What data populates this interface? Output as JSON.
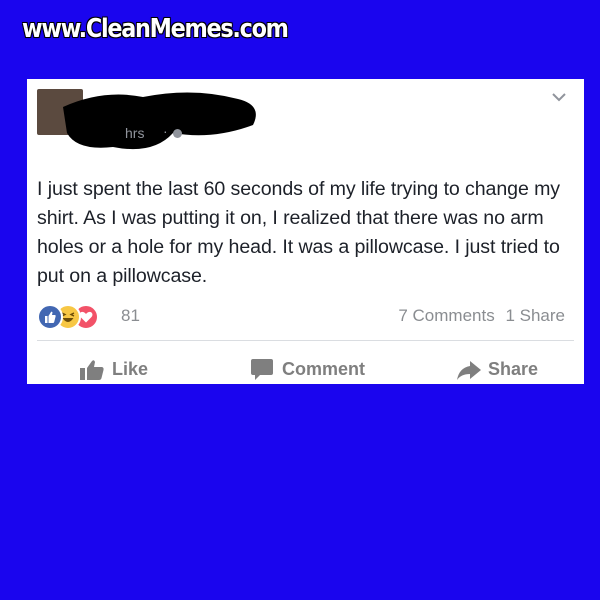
{
  "watermark": {
    "text": "www.CleanMemes.com"
  },
  "post": {
    "timestamp": "hrs",
    "text": "I just spent the last 60 seconds of my life trying to change my shirt. As I was putting it on, I realized that there was no arm holes or a hole for my head. It was a pillowcase. I just tried to put on a pillowcase.",
    "reactions": {
      "icons": [
        "like-icon",
        "haha-icon",
        "love-icon"
      ],
      "count": "81"
    },
    "comments_label": "7 Comments",
    "shares_label": "1 Share"
  },
  "actions": {
    "like_label": "Like",
    "comment_label": "Comment",
    "share_label": "Share"
  },
  "colors": {
    "background": "#1a05ee",
    "card": "#ffffff",
    "text": "#1d2129",
    "muted": "#8a8d91",
    "like_blue": "#4267b2",
    "haha_yellow": "#f7c744",
    "love_red": "#f25268"
  }
}
